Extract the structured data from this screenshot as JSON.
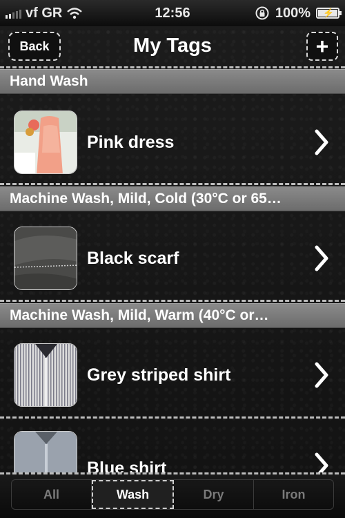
{
  "status_bar": {
    "carrier": "vf GR",
    "time": "12:56",
    "battery": "100%"
  },
  "nav": {
    "back_label": "Back",
    "title": "My Tags",
    "add_label": "+"
  },
  "sections": [
    {
      "header": "Hand Wash",
      "items": [
        {
          "label": "Pink dress",
          "thumb": "pink-dress"
        }
      ]
    },
    {
      "header": "Machine Wash, Mild, Cold (30°C or 65…",
      "items": [
        {
          "label": "Black scarf",
          "thumb": "black-scarf"
        }
      ]
    },
    {
      "header": "Machine Wash, Mild, Warm (40°C or…",
      "items": [
        {
          "label": "Grey striped shirt",
          "thumb": "grey-striped-shirt"
        }
      ]
    },
    {
      "header": "",
      "items": [
        {
          "label": "Blue shirt",
          "thumb": "blue-shirt"
        }
      ]
    }
  ],
  "tabs": [
    {
      "label": "All",
      "active": false
    },
    {
      "label": "Wash",
      "active": true
    },
    {
      "label": "Dry",
      "active": false
    },
    {
      "label": "Iron",
      "active": false
    }
  ],
  "colors": {
    "leather_bg": "#161616",
    "section_header_bg": "#7a7a7a",
    "stitch": "#bdbdbd",
    "tab_inactive_text": "#7a7a7a"
  }
}
